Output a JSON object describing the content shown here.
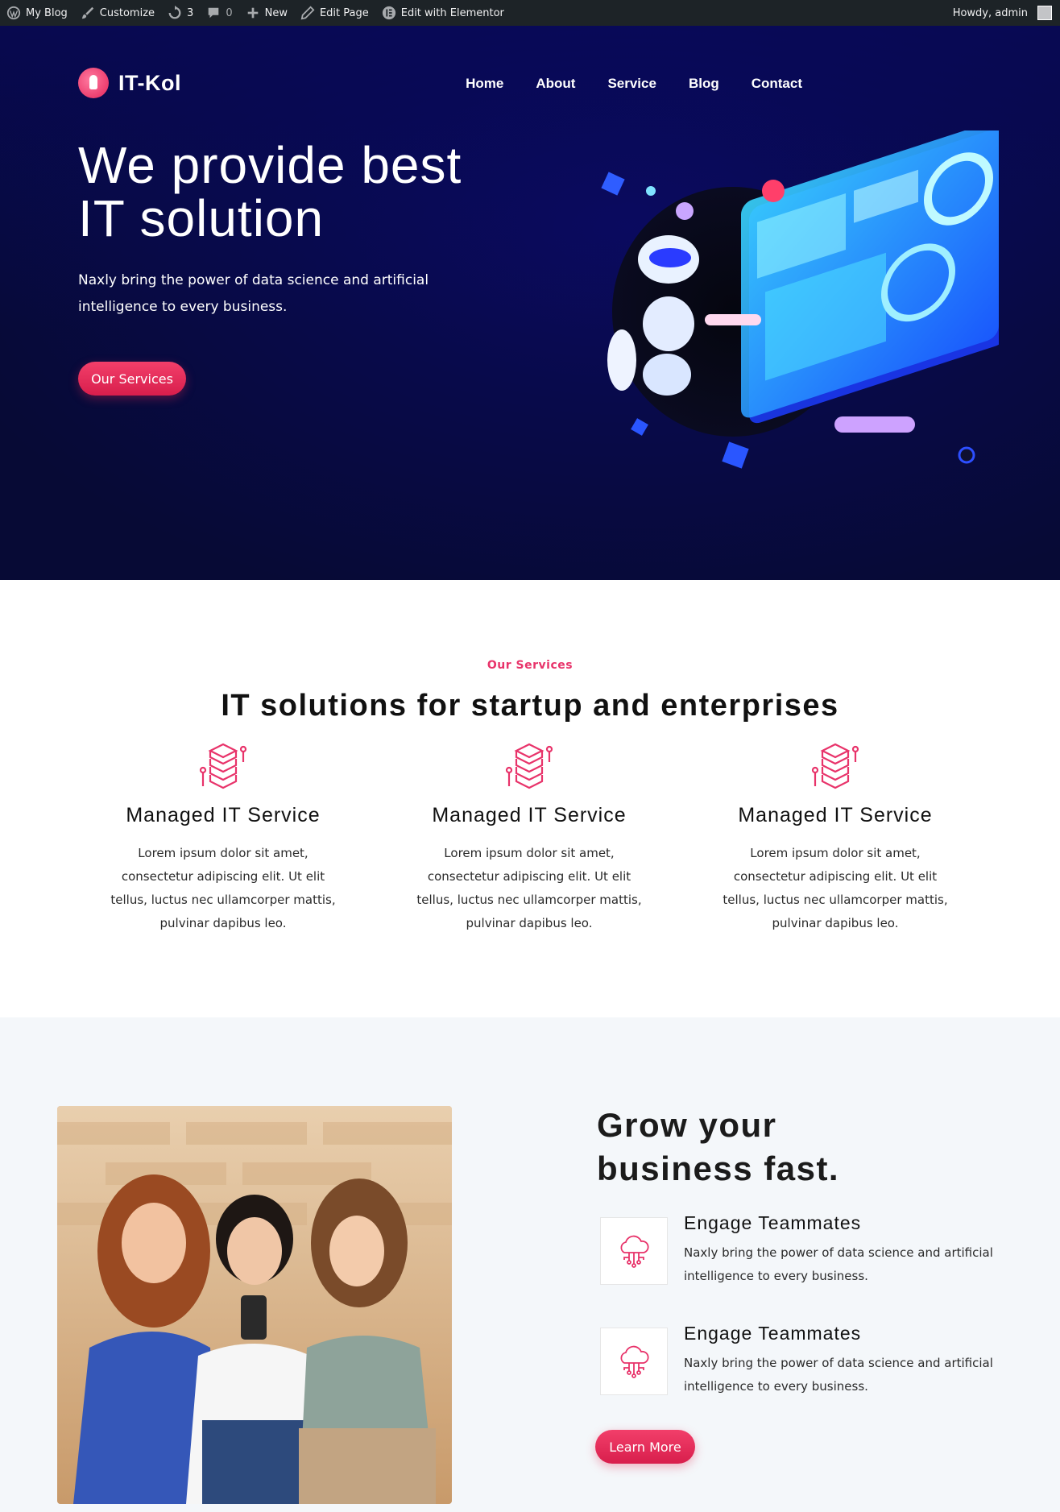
{
  "admin_bar": {
    "items": [
      "My Blog",
      "Customize",
      "3",
      "0",
      "New",
      "Edit Page",
      "Edit with Elementor"
    ],
    "greeting": "Howdy, admin"
  },
  "brand": {
    "name": "IT-Kol"
  },
  "nav": [
    "Home",
    "About",
    "Service",
    "Blog",
    "Contact"
  ],
  "hero": {
    "title_line1": "We provide best",
    "title_line2": "IT solution",
    "text": "Naxly bring the power of data science and artificial intelligence to every business.",
    "button": "Our Services"
  },
  "services": {
    "eyebrow": "Our Services",
    "title": "IT solutions for startup and enterprises",
    "cards": [
      {
        "title": "Managed IT Service",
        "text": "Lorem ipsum dolor sit amet, consectetur adipiscing elit. Ut elit tellus, luctus nec ullamcorper mattis, pulvinar dapibus leo."
      },
      {
        "title": "Managed IT Service",
        "text": "Lorem ipsum dolor sit amet, consectetur adipiscing elit. Ut elit tellus, luctus nec ullamcorper mattis, pulvinar dapibus leo."
      },
      {
        "title": "Managed IT Service",
        "text": "Lorem ipsum dolor sit amet, consectetur adipiscing elit. Ut elit tellus, luctus nec ullamcorper mattis, pulvinar dapibus leo."
      }
    ]
  },
  "grow": {
    "title_line1": "Grow your",
    "title_line2": "business fast.",
    "features": [
      {
        "title": "Engage Teammates",
        "text": "Naxly bring the power of data science and artificial intelligence to every business."
      },
      {
        "title": "Engage Teammates",
        "text": "Naxly bring the power of data science and artificial intelligence to every business."
      }
    ],
    "button": "Learn More"
  },
  "colors": {
    "accent": "#e8336a",
    "hero_bg": "#070a40",
    "admin_bar": "#1d2327",
    "section_bg": "#f4f7fa"
  },
  "icons": [
    "wordpress-icon",
    "brush-icon",
    "refresh-icon",
    "comment-icon",
    "plus-icon",
    "pencil-icon",
    "elementor-icon",
    "server-stack-icon",
    "cloud-network-icon"
  ]
}
